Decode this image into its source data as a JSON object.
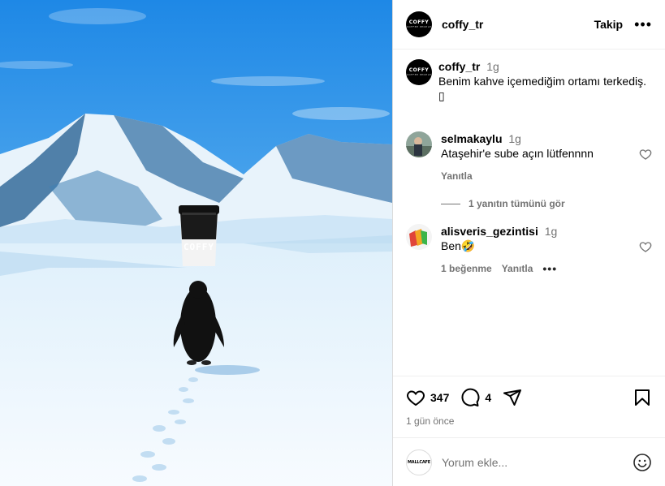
{
  "post": {
    "author": "coffy_tr",
    "follow_label": "Takip",
    "more_label": "•••",
    "avatar_logo": "COFFY",
    "avatar_logo_sub": "COFFEE PEOPLE",
    "cup_brand": "COFFY"
  },
  "caption": {
    "username": "coffy_tr",
    "time": "1g",
    "text": "Benim kahve içemediğim ortamı terkediş.",
    "trailing_glyph": "▯"
  },
  "comments": [
    {
      "username": "selmakaylu",
      "time": "1g",
      "text": "Ataşehir'e sube açın lütfennnn",
      "reply_label": "Yanıtla",
      "view_replies": "1 yanıtın tümünü gör"
    },
    {
      "username": "alisveris_gezintisi",
      "time": "1g",
      "text": "Ben",
      "emoji": "🤣",
      "likes_label": "1 beğenme",
      "reply_label": "Yanıtla",
      "more_label": "•••"
    }
  ],
  "footer": {
    "likes": "347",
    "comments": "4",
    "date": "1 gün önce"
  },
  "composer": {
    "placeholder": "Yorum ekle...",
    "avatar_text": "MALLCAFE"
  }
}
